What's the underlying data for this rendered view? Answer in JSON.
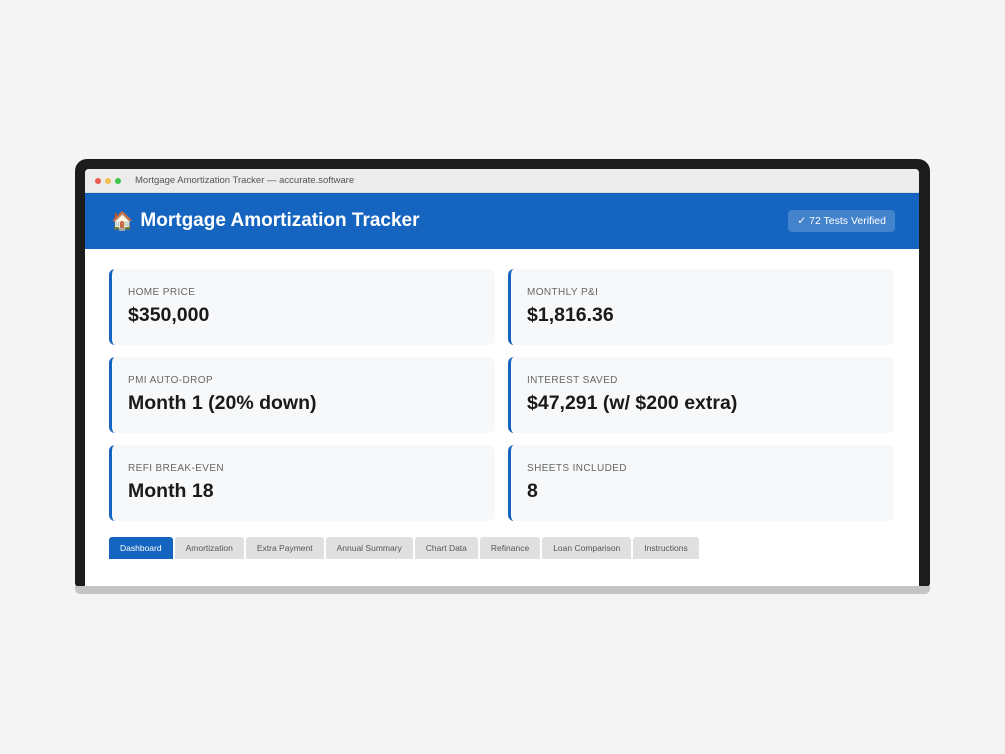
{
  "window": {
    "title": "Mortgage Amortization Tracker — accurate.software"
  },
  "header": {
    "icon": "house-icon",
    "emoji": "🏠",
    "title": "Mortgage Amortization Tracker",
    "badge": "✓ 72 Tests Verified"
  },
  "cards": [
    {
      "label": "Home Price",
      "value": "$350,000"
    },
    {
      "label": "Monthly P&I",
      "value": "$1,816.36"
    },
    {
      "label": "PMI Auto-Drop",
      "value": "Month 1 (20% down)"
    },
    {
      "label": "Interest Saved",
      "value": "$47,291 (w/ $200 extra)"
    },
    {
      "label": "Refi Break-Even",
      "value": "Month 18"
    },
    {
      "label": "Sheets Included",
      "value": "8"
    }
  ],
  "tabs": [
    {
      "label": "Dashboard",
      "active": true
    },
    {
      "label": "Amortization"
    },
    {
      "label": "Extra Payment"
    },
    {
      "label": "Annual Summary"
    },
    {
      "label": "Chart Data"
    },
    {
      "label": "Refinance"
    },
    {
      "label": "Loan Comparison"
    },
    {
      "label": "Instructions"
    }
  ],
  "colors": {
    "accent": "#1565c0",
    "card_bg": "#f6f8fa",
    "tab_inactive": "#e0e0e0",
    "dot_red": "#ee5a52",
    "dot_yellow": "#f4bd4f",
    "dot_green": "#3fc54a"
  }
}
